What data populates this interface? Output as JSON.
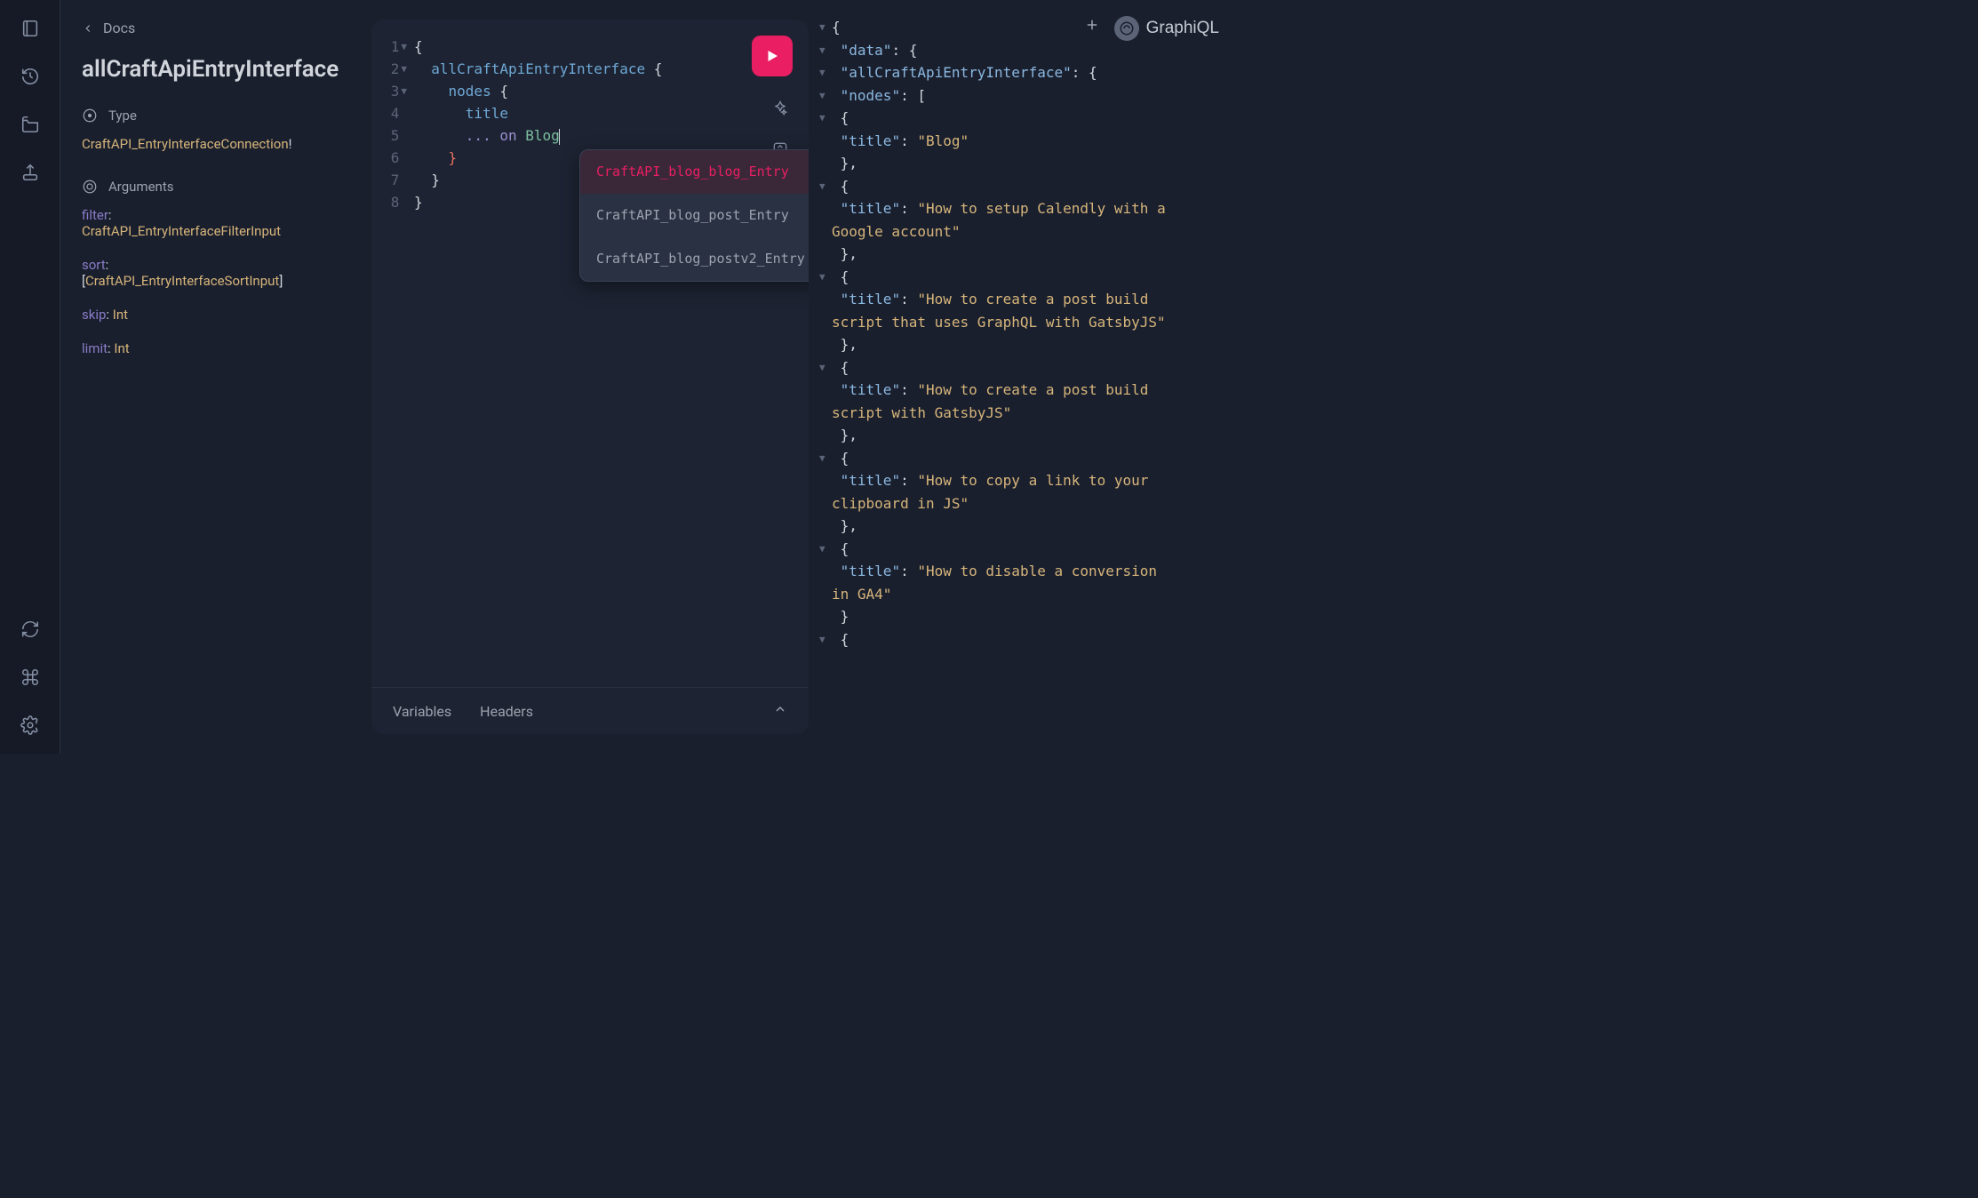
{
  "brand": "GraphiQL",
  "docs": {
    "back_label": "Docs",
    "title": "allCraftApiEntryInterface",
    "type_heading": "Type",
    "type_value": "CraftAPI_EntryInterfaceConnection",
    "arguments_heading": "Arguments",
    "args": [
      {
        "name": "filter",
        "type": "CraftAPI_EntryInterfaceFilterInput",
        "wrap": "plain"
      },
      {
        "name": "sort",
        "type": "CraftAPI_EntryInterfaceSortInput",
        "wrap": "list"
      },
      {
        "name": "skip",
        "type": "Int",
        "wrap": "plain"
      },
      {
        "name": "limit",
        "type": "Int",
        "wrap": "plain"
      }
    ]
  },
  "editor": {
    "lines": [
      {
        "n": 1,
        "fold": true,
        "tokens": [
          {
            "t": "brace",
            "v": "{"
          }
        ]
      },
      {
        "n": 2,
        "fold": true,
        "tokens": [
          {
            "t": "plain",
            "v": "  "
          },
          {
            "t": "field",
            "v": "allCraftApiEntryInterface"
          },
          {
            "t": "plain",
            "v": " "
          },
          {
            "t": "brace",
            "v": "{"
          }
        ]
      },
      {
        "n": 3,
        "fold": true,
        "tokens": [
          {
            "t": "plain",
            "v": "    "
          },
          {
            "t": "field",
            "v": "nodes"
          },
          {
            "t": "plain",
            "v": " "
          },
          {
            "t": "brace",
            "v": "{"
          }
        ]
      },
      {
        "n": 4,
        "fold": false,
        "tokens": [
          {
            "t": "plain",
            "v": "      "
          },
          {
            "t": "field",
            "v": "title"
          }
        ]
      },
      {
        "n": 5,
        "fold": false,
        "tokens": [
          {
            "t": "plain",
            "v": "      "
          },
          {
            "t": "on",
            "v": "... on"
          },
          {
            "t": "plain",
            "v": " "
          },
          {
            "t": "frag",
            "v": "Blog"
          }
        ],
        "caret": true
      },
      {
        "n": 6,
        "fold": false,
        "tokens": [
          {
            "t": "plain",
            "v": "    "
          },
          {
            "t": "err",
            "v": "}"
          }
        ]
      },
      {
        "n": 7,
        "fold": false,
        "tokens": [
          {
            "t": "plain",
            "v": "  "
          },
          {
            "t": "brace",
            "v": "}"
          }
        ]
      },
      {
        "n": 8,
        "fold": false,
        "tokens": [
          {
            "t": "brace",
            "v": "}"
          }
        ]
      }
    ],
    "autocomplete": [
      "CraftAPI_blog_blog_Entry",
      "CraftAPI_blog_post_Entry",
      "CraftAPI_blog_postv2_Entry"
    ],
    "autocomplete_selected": 0,
    "bottom_tabs": {
      "variables": "Variables",
      "headers": "Headers"
    }
  },
  "result": {
    "data": {
      "allCraftApiEntryInterface": {
        "nodes": [
          {
            "title": "Blog"
          },
          {
            "title": "How to setup Calendly with a Google account"
          },
          {
            "title": "How to create a post build script that uses GraphQL with GatsbyJS"
          },
          {
            "title": "How to create a post build script with GatsbyJS"
          },
          {
            "title": "How to copy a link to your clipboard in JS"
          },
          {
            "title": "How to disable a conversion in GA4"
          }
        ]
      }
    }
  }
}
